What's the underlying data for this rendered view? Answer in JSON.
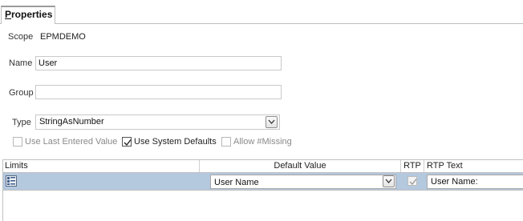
{
  "tabs": [
    {
      "label_first": "P",
      "label_rest": "roperties"
    }
  ],
  "scope": {
    "label": "Scope",
    "value": "EPMDEMO"
  },
  "name": {
    "label": "Name",
    "value": "User"
  },
  "group": {
    "label": "Group",
    "value": ""
  },
  "type": {
    "label": "Type",
    "value": "StringAsNumber"
  },
  "options": {
    "use_last_entered": {
      "label": "Use Last Entered Value",
      "checked": false,
      "enabled": false
    },
    "use_system_defaults": {
      "label": "Use System Defaults",
      "checked": true,
      "enabled": true
    },
    "allow_missing": {
      "label": "Allow #Missing",
      "checked": false,
      "enabled": false
    }
  },
  "grid": {
    "headers": {
      "limits": "Limits",
      "default_value": "Default Value",
      "rtp": "RTP",
      "rtp_text": "RTP Text"
    },
    "rows": [
      {
        "limits_icon": "limits-editor-icon",
        "default_value": "User Name",
        "rtp": true,
        "rtp_text": "User Name:"
      }
    ]
  },
  "colors": {
    "selected_row": "#b4c8de",
    "header_border": "#c0c0c0"
  }
}
